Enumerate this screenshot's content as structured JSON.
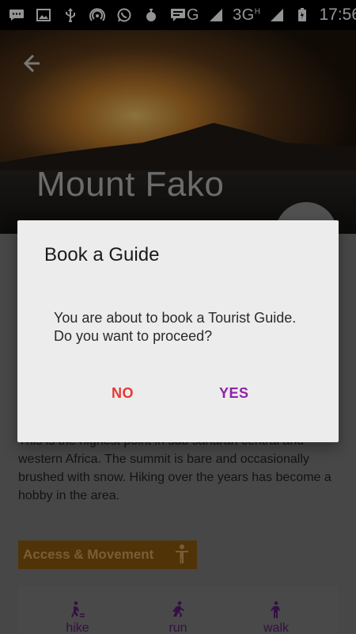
{
  "status_bar": {
    "network_label": "G",
    "mobile_label": "3G",
    "mobile_superscript": "H",
    "time": "17:56",
    "icons": [
      "chat-icon",
      "image-icon",
      "usb-icon",
      "hotspot-icon",
      "whatsapp-icon",
      "fruit-icon",
      "message-icon",
      "signal-icon",
      "battery-icon"
    ]
  },
  "header": {
    "title": "Mount Fako"
  },
  "content": {
    "description": "This is the highest point in sub saharan central and western Africa. The summit is bare and occasionally brushed with snow. Hiking over the years has become a hobby in the area.",
    "section_label": "Access & Movement",
    "movement": {
      "hike": "hike",
      "run": "run",
      "walk": "walk"
    }
  },
  "dialog": {
    "title": "Book a Guide",
    "message": "You are about to book a Tourist Guide. Do you want to proceed?",
    "no_label": "NO",
    "yes_label": "YES"
  },
  "colors": {
    "no": "#e53935",
    "yes": "#8e24aa",
    "section_bg": "#d7860f"
  }
}
